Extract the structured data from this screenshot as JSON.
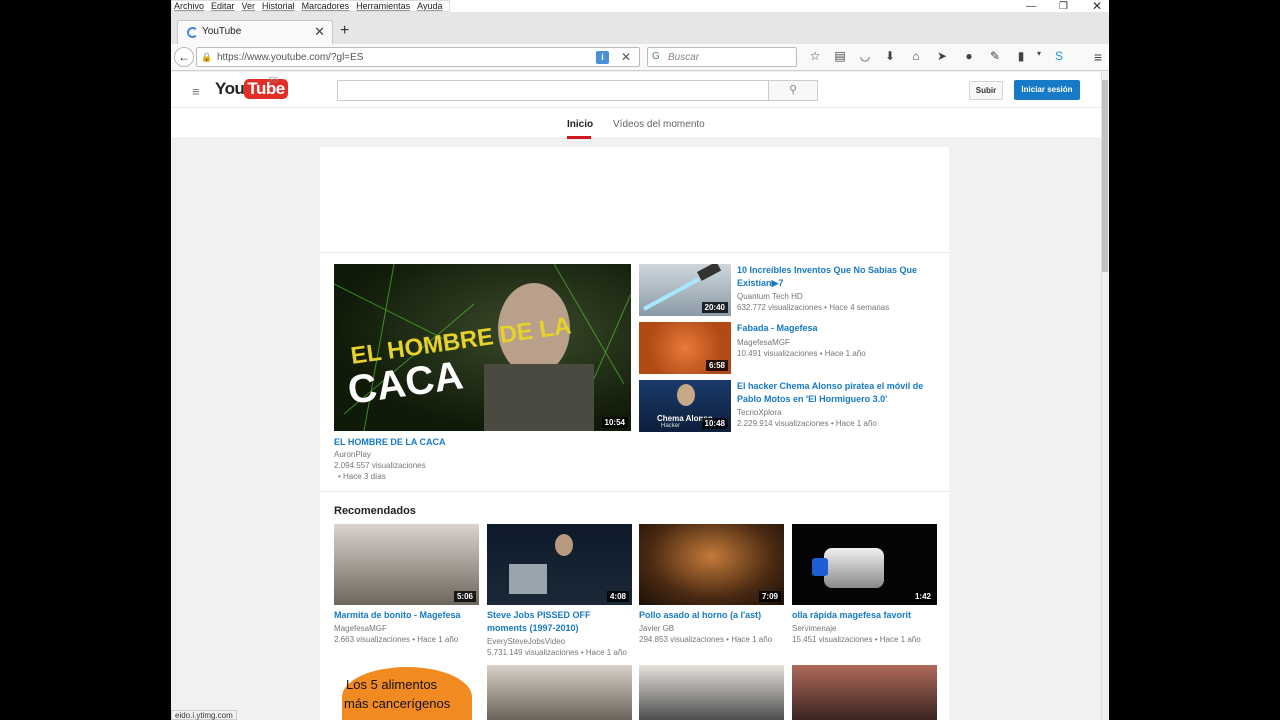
{
  "browser": {
    "menu": [
      "Archivo",
      "Editar",
      "Ver",
      "Historial",
      "Marcadores",
      "Herramientas",
      "Ayuda"
    ],
    "tab_title": "YouTube",
    "url": "https://www.youtube.com/?gl=ES",
    "search_placeholder": "Buscar",
    "status_text": "eido.i.ytimg.com"
  },
  "yt": {
    "logo_you": "You",
    "logo_tube": "Tube",
    "logo_region": "ES",
    "upload_label": "Subir",
    "signin_label": "Iniciar sesión",
    "tabs": [
      {
        "label": "Inicio"
      },
      {
        "label": "Vídeos del momento"
      }
    ]
  },
  "featured": {
    "main": {
      "title": "EL HOMBRE DE LA CACA",
      "channel": "AuronPlay",
      "views": "2.094.557 visualizaciones",
      "age": "• Hace 3 días",
      "duration": "10:54",
      "thumb_text_1": "EL HOMBRE DE LA",
      "thumb_text_2": "CACA"
    },
    "side": [
      {
        "title": "10 Increíbles Inventos Que No Sabías Que Existían▶7",
        "channel": "Quantum Tech HD",
        "meta": "632.772 visualizaciones  •  Hace 4 semanas",
        "duration": "20:40"
      },
      {
        "title": "Fabada - Magefesa",
        "channel": "MagefesaMGF",
        "meta": "10.491 visualizaciones  •  Hace 1 año",
        "duration": "6:58"
      },
      {
        "title": "El hacker Chema Alonso piratea el móvil de Pablo Motos en 'El Hormiguero 3.0'",
        "channel": "TecnoXplora",
        "meta": "2.229.914 visualizaciones  •  Hace 1 año",
        "duration": "10:48",
        "thumb_text": "Chema Alonso",
        "thumb_sub": "Hacker"
      }
    ]
  },
  "recommended": {
    "title": "Recomendados",
    "items": [
      {
        "title": "Marmita de bonito - Magefesa",
        "channel": "MagefesaMGF",
        "meta": "2.663 visualizaciones  •  Hace 1 año",
        "duration": "5:06"
      },
      {
        "title": "Steve Jobs PISSED OFF moments (1997-2010)",
        "channel": "EverySteveJobsVideo",
        "meta": "5.731.149 visualizaciones  •  Hace 1 año",
        "duration": "4:08"
      },
      {
        "title": "Pollo asado al horno (a l'ast)",
        "channel": "Javier GB",
        "meta": "294.853 visualizaciones  •  Hace 1 año",
        "duration": "7:09"
      },
      {
        "title": "olla rápida magefesa favorit",
        "channel": "Servimenaje",
        "meta": "15.451 visualizaciones  •  Hace 1 año",
        "duration": "1:42"
      }
    ],
    "row2_thumb_text_1": "Los 5 alimentos",
    "row2_thumb_text_2": "más cancerígenos"
  }
}
